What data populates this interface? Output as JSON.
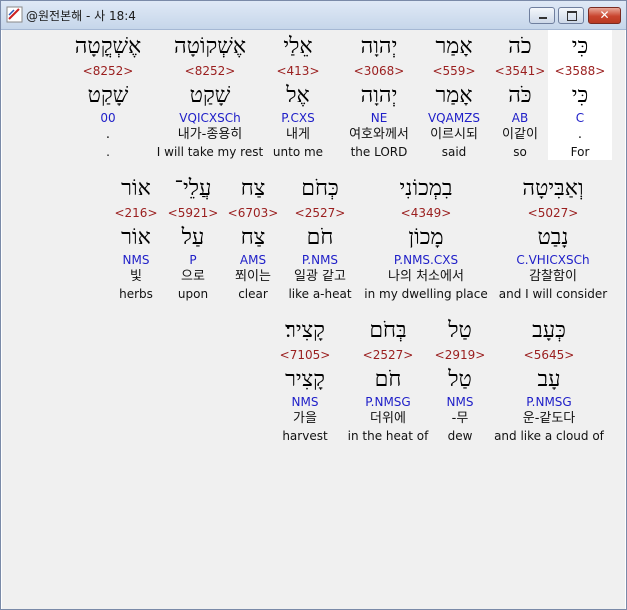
{
  "window": {
    "title": "@원전본해 - 사 18:4",
    "close_glyph": "✕"
  },
  "rows": [
    {
      "words": [
        {
          "hebrew": "כִּי",
          "strong": "<3588>",
          "lexeme": "כִּי",
          "morph": "C",
          "korean": ".",
          "english": "For",
          "highlighted": true
        },
        {
          "hebrew": "כֹה",
          "strong": "<3541>",
          "lexeme": "כֹּה",
          "morph": "AB",
          "korean": "이같이",
          "english": "so"
        },
        {
          "hebrew": "אָמַר",
          "strong": "<559>",
          "lexeme": "אָמַר",
          "morph": "VQAMZS",
          "korean": "이르시되",
          "english": "said"
        },
        {
          "hebrew": "יְהוָה",
          "strong": "<3068>",
          "lexeme": "יְהוָה",
          "morph": "NE",
          "korean": "여호와께서",
          "english": "the LORD"
        },
        {
          "hebrew": "אֵלַי",
          "strong": "<413>",
          "lexeme": "אֶל",
          "morph": "P.CXS",
          "korean": "내게",
          "english": "unto me"
        },
        {
          "hebrew": "אֶשְׁקוֹטָה",
          "strong": "<8252>",
          "lexeme": "שָׁקַט",
          "morph": "VQICXSCh",
          "korean": "내가-종용히",
          "english": "I will take my rest"
        },
        {
          "hebrew": "אֶשְׁקֳטָה",
          "strong": "<8252>",
          "lexeme": "שָׁקַט",
          "morph": "00",
          "korean": ".",
          "english": "."
        }
      ]
    },
    {
      "words": [
        {
          "hebrew": "וְאַבִּיטָה",
          "strong": "<5027>",
          "lexeme": "נָבַט",
          "morph": "C.VHICXSCh",
          "korean": "감찰함이",
          "english": "and I will consider"
        },
        {
          "hebrew": "בִמְכוֹנִי",
          "strong": "<4349>",
          "lexeme": "מָכוֹן",
          "morph": "P.NMS.CXS",
          "korean": "나의 처소에서",
          "english": "in my dwelling place"
        },
        {
          "hebrew": "כְּחֹם",
          "strong": "<2527>",
          "lexeme": "חֹם",
          "morph": "P.NMS",
          "korean": "일광 같고",
          "english": "like a-heat"
        },
        {
          "hebrew": "צַח",
          "strong": "<6703>",
          "lexeme": "צַח",
          "morph": "AMS",
          "korean": "쬐이는",
          "english": "clear"
        },
        {
          "hebrew": "עֲלֵי־",
          "strong": "<5921>",
          "lexeme": "עַל",
          "morph": "P",
          "korean": "으로",
          "english": "upon"
        },
        {
          "hebrew": "אוֹר",
          "strong": "<216>",
          "lexeme": "אוֹר",
          "morph": "NMS",
          "korean": "빛",
          "english": "herbs"
        }
      ]
    },
    {
      "words": [
        {
          "hebrew": "כְּעָב",
          "strong": "<5645>",
          "lexeme": "עָב",
          "morph": "P.NMSG",
          "korean": "운-같도다",
          "english": "and like a cloud of"
        },
        {
          "hebrew": "טַל",
          "strong": "<2919>",
          "lexeme": "טַל",
          "morph": "NMS",
          "korean": "-무",
          "english": "dew"
        },
        {
          "hebrew": "בְּחֹם",
          "strong": "<2527>",
          "lexeme": "חֹם",
          "morph": "P.NMSG",
          "korean": "더위에",
          "english": "in the heat of"
        },
        {
          "hebrew": "קָצִיר׃",
          "strong": "<7105>",
          "lexeme": "קָצִיר",
          "morph": "NMS",
          "korean": "가을",
          "english": "harvest"
        }
      ]
    }
  ]
}
